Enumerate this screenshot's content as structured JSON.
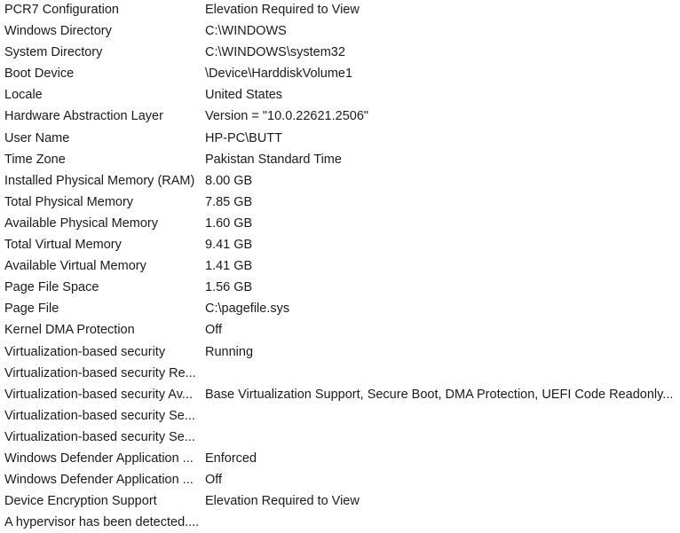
{
  "rows": [
    {
      "item": "PCR7 Configuration",
      "value": "Elevation Required to View"
    },
    {
      "item": "Windows Directory",
      "value": "C:\\WINDOWS"
    },
    {
      "item": "System Directory",
      "value": "C:\\WINDOWS\\system32"
    },
    {
      "item": "Boot Device",
      "value": "\\Device\\HarddiskVolume1"
    },
    {
      "item": "Locale",
      "value": "United States"
    },
    {
      "item": "Hardware Abstraction Layer",
      "value": "Version = \"10.0.22621.2506\""
    },
    {
      "item": "User Name",
      "value": "HP-PC\\BUTT"
    },
    {
      "item": "Time Zone",
      "value": "Pakistan Standard Time"
    },
    {
      "item": "Installed Physical Memory (RAM)",
      "value": "8.00 GB"
    },
    {
      "item": "Total Physical Memory",
      "value": "7.85 GB"
    },
    {
      "item": "Available Physical Memory",
      "value": "1.60 GB"
    },
    {
      "item": "Total Virtual Memory",
      "value": "9.41 GB"
    },
    {
      "item": "Available Virtual Memory",
      "value": "1.41 GB"
    },
    {
      "item": "Page File Space",
      "value": "1.56 GB"
    },
    {
      "item": "Page File",
      "value": "C:\\pagefile.sys"
    },
    {
      "item": "Kernel DMA Protection",
      "value": "Off"
    },
    {
      "item": "Virtualization-based security",
      "value": "Running"
    },
    {
      "item": "Virtualization-based security Re...",
      "value": ""
    },
    {
      "item": "Virtualization-based security Av...",
      "value": "Base Virtualization Support, Secure Boot, DMA Protection, UEFI Code Readonly..."
    },
    {
      "item": "Virtualization-based security Se...",
      "value": ""
    },
    {
      "item": "Virtualization-based security Se...",
      "value": ""
    },
    {
      "item": "Windows Defender Application ...",
      "value": "Enforced"
    },
    {
      "item": "Windows Defender Application ...",
      "value": "Off"
    },
    {
      "item": "Device Encryption Support",
      "value": "Elevation Required to View"
    },
    {
      "item": "A hypervisor has been detected....",
      "value": ""
    }
  ]
}
